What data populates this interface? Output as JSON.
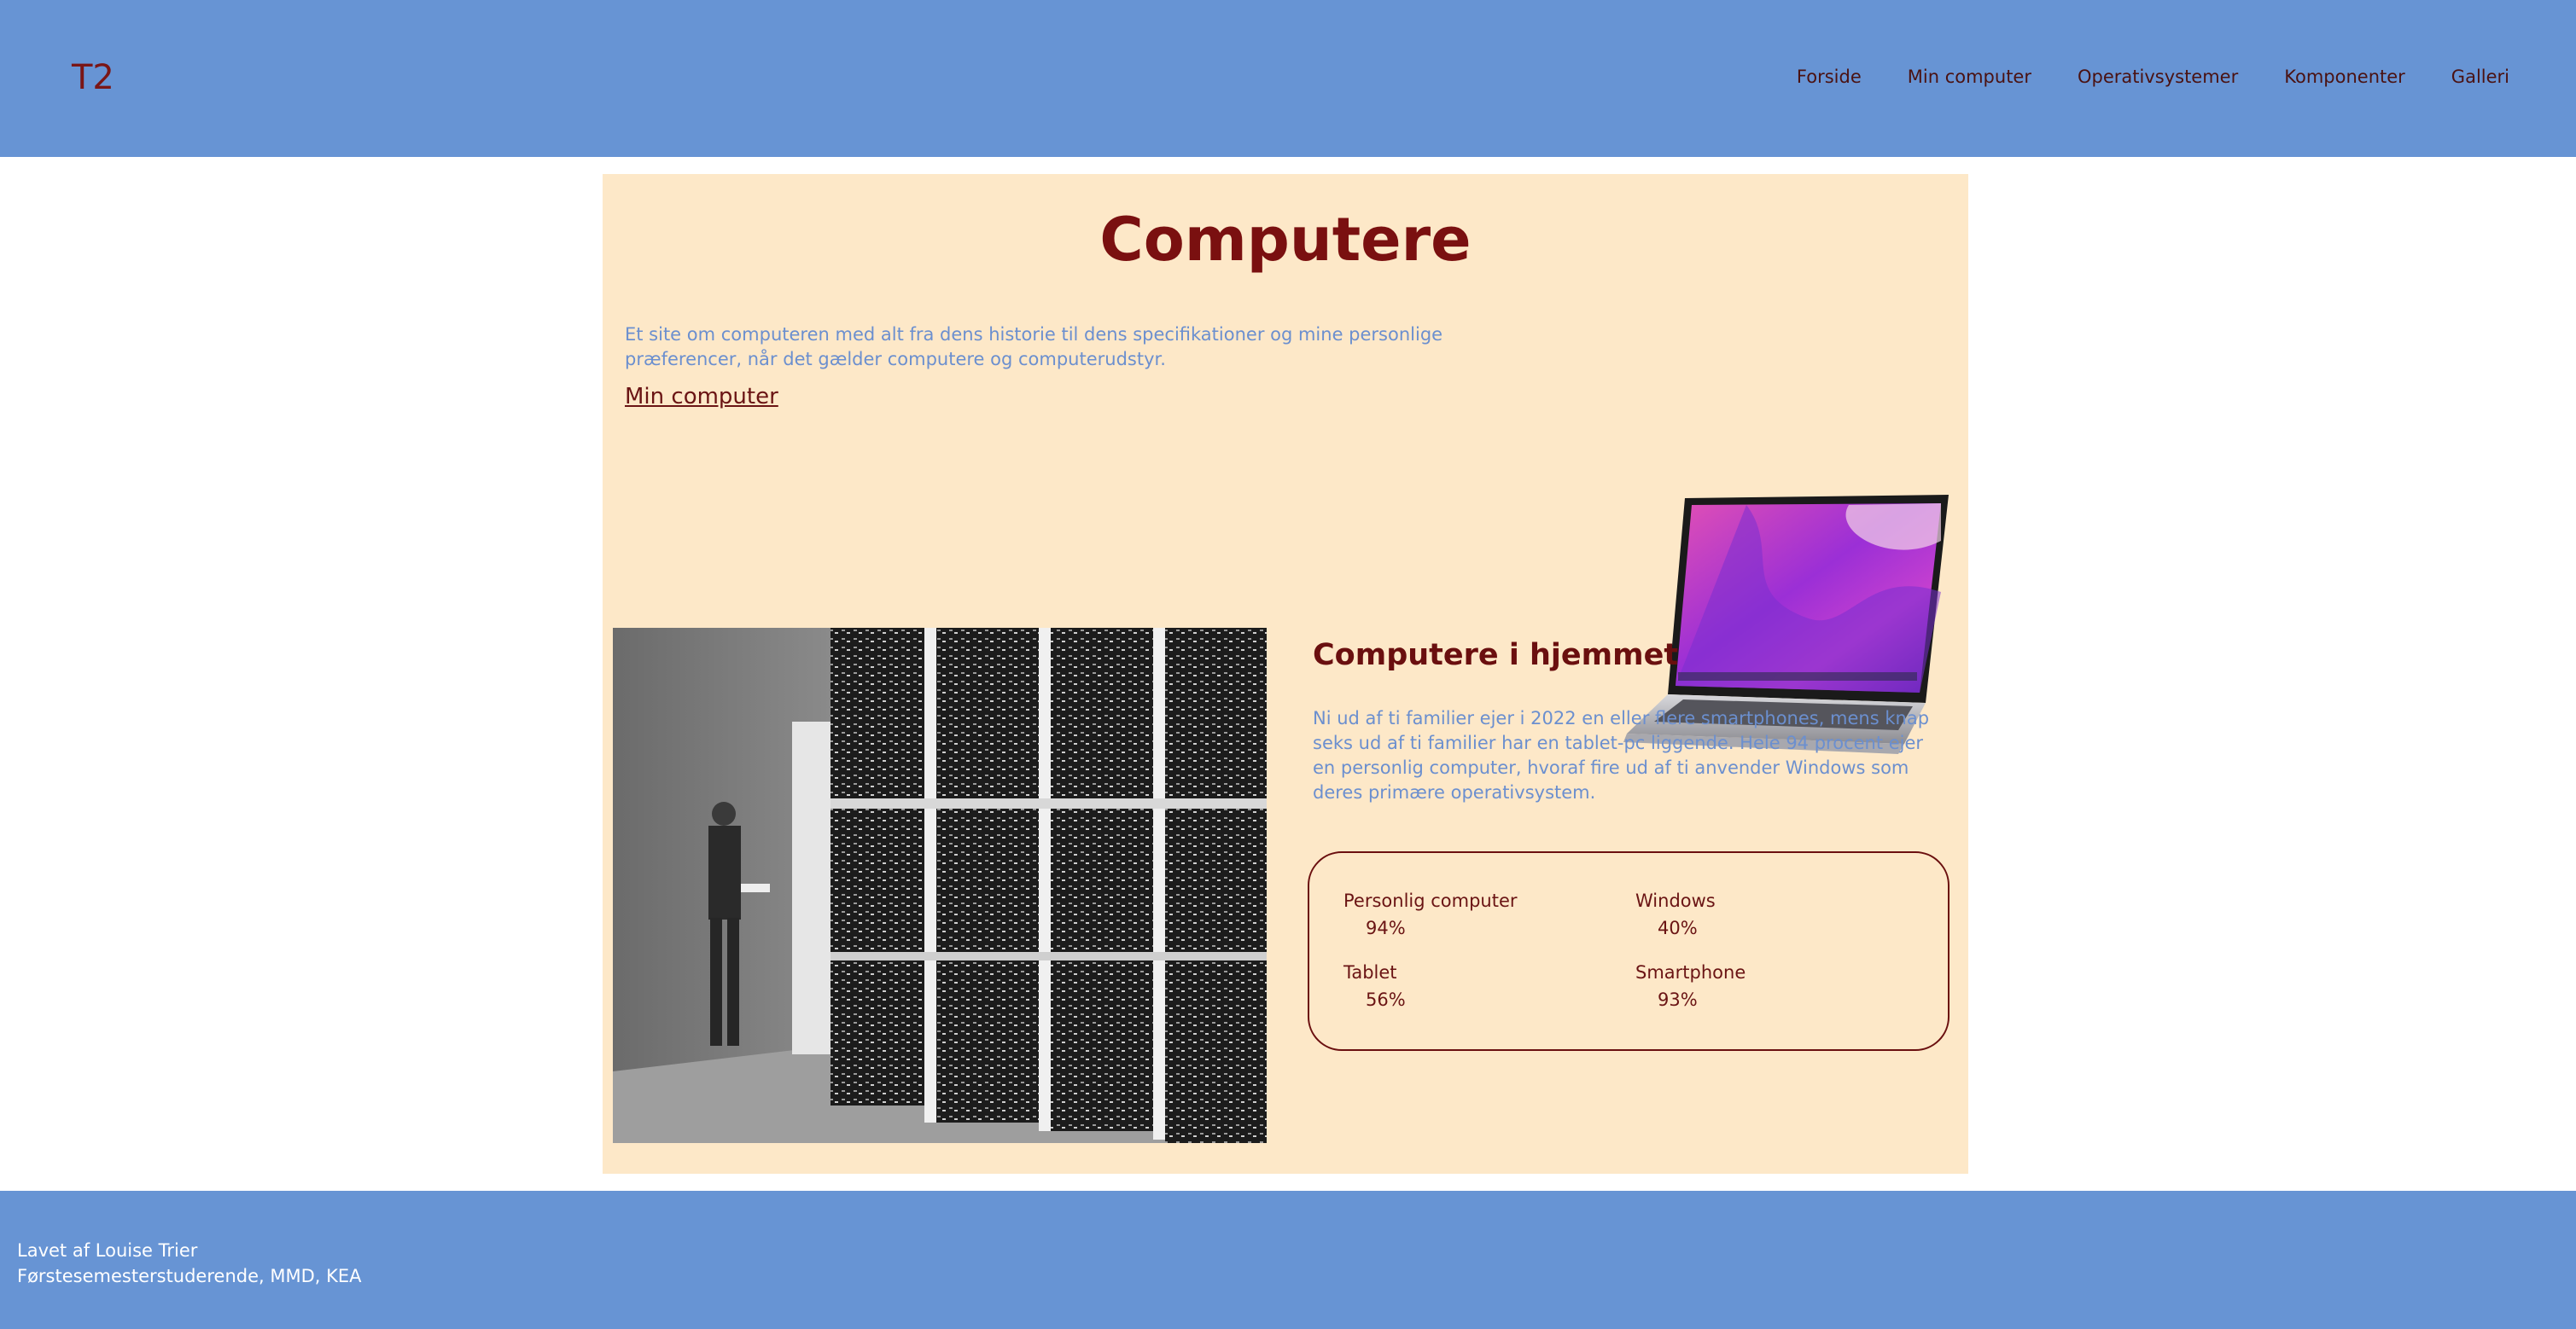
{
  "header": {
    "logo": "T2",
    "nav": [
      "Forside",
      "Min computer",
      "Operativsystemer",
      "Komponenter",
      "Galleri"
    ]
  },
  "main": {
    "title": "Computere",
    "intro": "Et site om computeren med alt fra dens historie til dens specifikationer og mine personlige præferencer, når det gælder computere og computerudstyr.",
    "intro_link": "Min computer",
    "section": {
      "heading": "Computere i hjemmet",
      "paragraph": "Ni ud af ti familier ejer i 2022 en eller flere smartphones, mens knap seks ud af ti familier har en tablet-pc liggende. Hele 94 procent ejer en personlig computer, hvoraf fire ud af ti anvender Windows som deres primære operativsystem.",
      "stats": [
        {
          "label": "Personlig computer",
          "value": "94%"
        },
        {
          "label": "Windows",
          "value": "40%"
        },
        {
          "label": "Tablet",
          "value": "56%"
        },
        {
          "label": "Smartphone",
          "value": "93%"
        }
      ]
    }
  },
  "footer": {
    "line1": "Lavet af Louise Trier",
    "line2": "Førstesemesterstuderende, MMD, KEA"
  },
  "colors": {
    "header_bg": "#6794d4",
    "content_bg": "#fde8c8",
    "heading": "#7a1010",
    "body_text": "#6b8fcf"
  },
  "icons": {
    "laptop": "laptop-image",
    "photo": "vintage-computer-photo"
  }
}
